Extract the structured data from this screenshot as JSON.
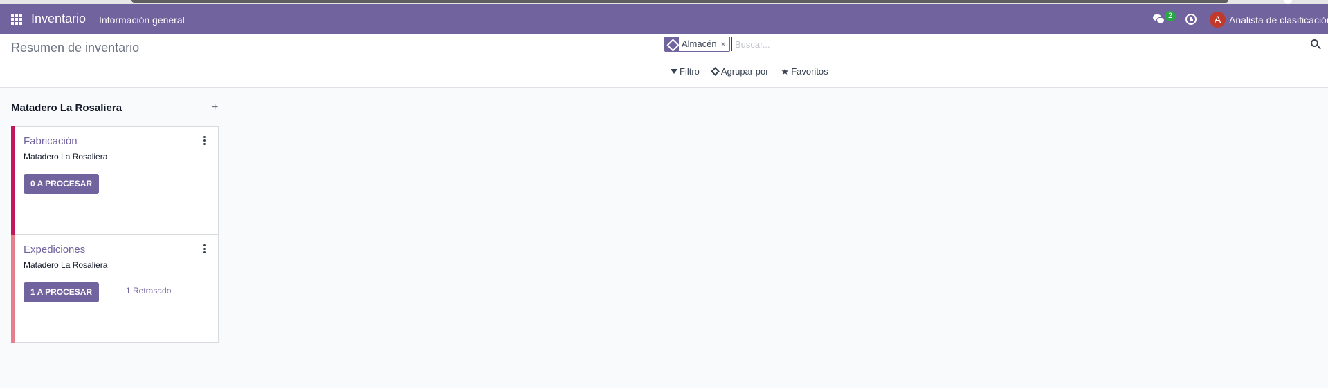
{
  "navbar": {
    "app_name": "Inventario",
    "menu_item": "Información general",
    "messages_badge": "2",
    "user_initial": "A",
    "user_name": "Analista de clasificación",
    "bg_color": "#71639e"
  },
  "control_panel": {
    "breadcrumb": "Resumen de inventario",
    "search": {
      "facet_label": "Almacén",
      "facet_remove": "×",
      "placeholder": "Buscar..."
    },
    "filters": {
      "filter_label": "Filtro",
      "group_by_label": "Agrupar por",
      "favorites_label": "Favoritos"
    }
  },
  "group": {
    "title": "Matadero La Rosaliera",
    "add_symbol": "+",
    "cards": [
      {
        "title": "Fabricación",
        "warehouse": "Matadero La Rosaliera",
        "button_label": "0 A PROCESAR",
        "late_label": "",
        "stripe_color": "#c2185b"
      },
      {
        "title": "Expediciones",
        "warehouse": "Matadero La Rosaliera",
        "button_label": "1 A PROCESAR",
        "late_label": "1 Retrasado",
        "stripe_color": "#e57f8b"
      }
    ]
  }
}
